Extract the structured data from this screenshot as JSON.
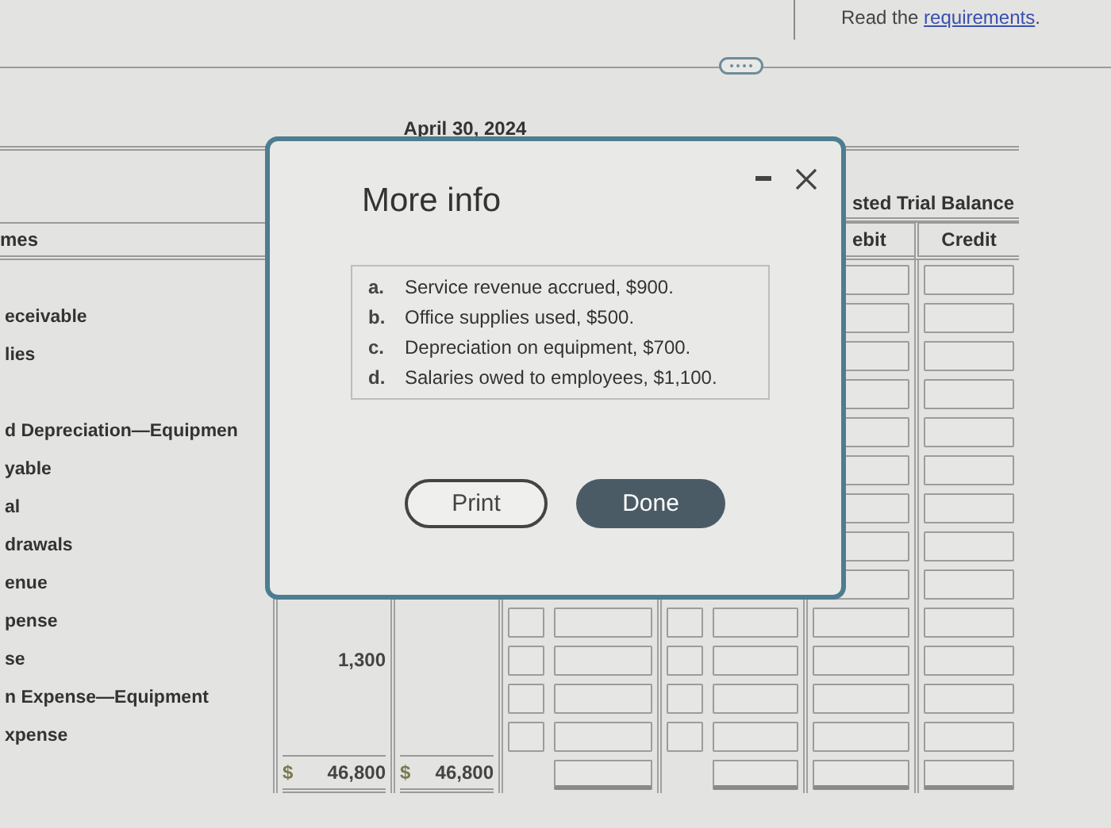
{
  "requirements_prompt": {
    "text": "Read the",
    "link": "requirements",
    "suffix": "."
  },
  "date": "April 30, 2024",
  "table": {
    "group_header": "sted Trial Balance",
    "columns": [
      "mes",
      "ebit",
      "Credit"
    ],
    "rows": [
      {
        "kind": "account"
      },
      {
        "kind": "account",
        "account": "eceivable"
      },
      {
        "kind": "account",
        "account": "lies"
      },
      {
        "kind": "account"
      },
      {
        "kind": "account",
        "account": "d Depreciation—Equipmen"
      },
      {
        "kind": "account",
        "account": "yable"
      },
      {
        "kind": "account",
        "account": "al"
      },
      {
        "kind": "account",
        "account": "drawals"
      },
      {
        "kind": "account",
        "account": "enue"
      },
      {
        "kind": "account",
        "account": "pense"
      },
      {
        "kind": "account",
        "account": "se",
        "unadjusted_debit": {
          "amount": "1,300"
        }
      },
      {
        "kind": "account",
        "account": "n Expense—Equipment"
      },
      {
        "kind": "account",
        "account": "xpense"
      },
      {
        "kind": "total",
        "unadjusted_debit": {
          "currency": "$",
          "amount": "46,800"
        },
        "unadjusted_credit": {
          "currency": "$",
          "amount": "46,800"
        }
      }
    ]
  },
  "dialog": {
    "title": "More info",
    "items": [
      {
        "letter": "a.",
        "text": "Service revenue accrued, $900."
      },
      {
        "letter": "b.",
        "text": "Office supplies used, $500."
      },
      {
        "letter": "c.",
        "text": "Depreciation on equipment, $700."
      },
      {
        "letter": "d.",
        "text": "Salaries owed to employees, $1,100."
      }
    ],
    "buttons": [
      {
        "label": "Print",
        "kind": "secondary"
      },
      {
        "label": "Done",
        "kind": "primary"
      }
    ]
  }
}
